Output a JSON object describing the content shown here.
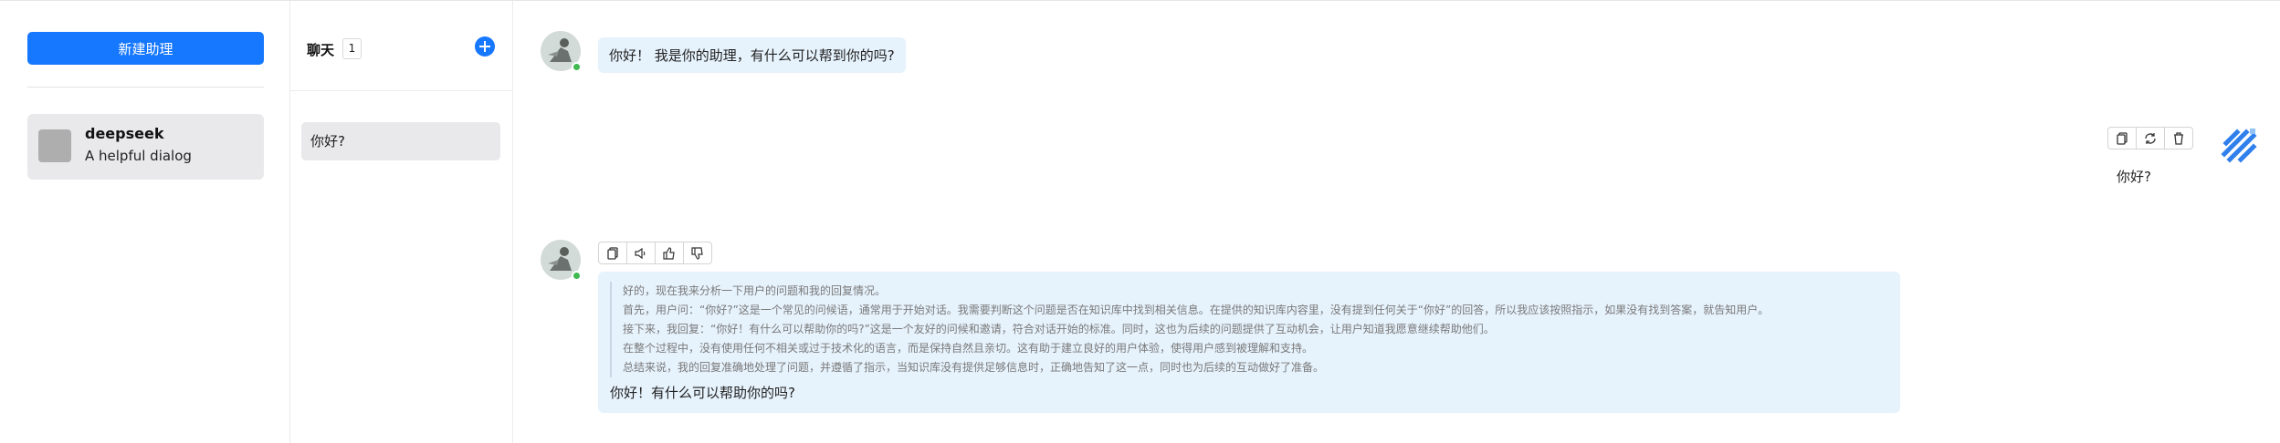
{
  "sidebar": {
    "new_assistant_label": "新建助理",
    "assistants": [
      {
        "name": "deepseek",
        "description": "A helpful dialog"
      }
    ]
  },
  "chats_panel": {
    "title": "聊天",
    "count": "1",
    "items": [
      {
        "label": "你好?"
      }
    ]
  },
  "conversation": {
    "greeting": "你好！ 我是你的助理，有什么可以帮到你的吗?",
    "user_message": "你好?",
    "reasoning_lines": [
      "好的，现在我来分析一下用户的问题和我的回复情况。",
      "首先，用户问：“你好?”这是一个常见的问候语，通常用于开始对话。我需要判断这个问题是否在知识库中找到相关信息。在提供的知识库内容里，没有提到任何关于“你好”的回答，所以我应该按照指示，如果没有找到答案，就告知用户。",
      "接下来，我回复：“你好！有什么可以帮助你的吗?”这是一个友好的问候和邀请，符合对话开始的标准。同时，这也为后续的问题提供了互动机会，让用户知道我愿意继续帮助他们。",
      "在整个过程中，没有使用任何不相关或过于技术化的语言，而是保持自然且亲切。这有助于建立良好的用户体验，使得用户感到被理解和支持。",
      "总结来说，我的回复准确地处理了问题，并遵循了指示，当知识库没有提供足够信息时，正确地告知了这一点，同时也为后续的互动做好了准备。"
    ],
    "final_answer": "你好！有什么可以帮助你的吗?"
  },
  "colors": {
    "accent": "#1677ff",
    "online": "#3fb950",
    "bubble": "#e6f2fc"
  },
  "icons": {
    "user_actions": [
      "copy-icon",
      "refresh-icon",
      "delete-icon"
    ],
    "bot_actions": [
      "copy-icon",
      "speaker-icon",
      "thumbs-up-icon",
      "thumbs-down-icon"
    ]
  }
}
